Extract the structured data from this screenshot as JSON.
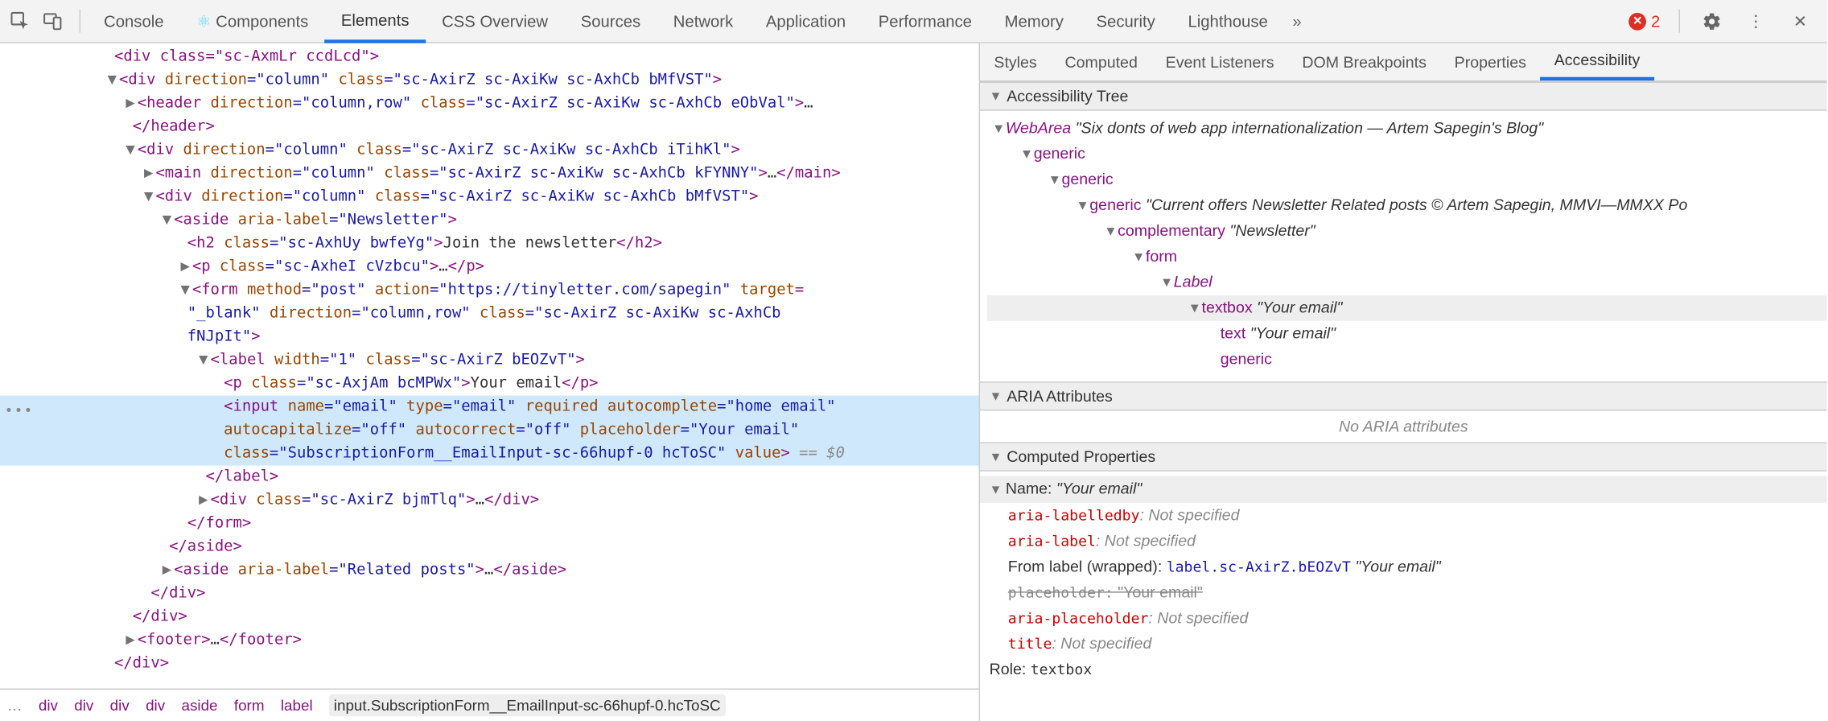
{
  "toolbar": {
    "tabs": [
      "Console",
      "Components",
      "Elements",
      "CSS Overview",
      "Sources",
      "Network",
      "Application",
      "Performance",
      "Memory",
      "Security",
      "Lighthouse"
    ],
    "active": 2,
    "error_count": "2"
  },
  "dom": {
    "l00": "<div class=\"sc-AxmLr ccdLcd\">",
    "l01_open": "<",
    "l01_tag": "div",
    "l01_a1n": " direction",
    "l01_a1v": "=\"column\"",
    "l01_a2n": " class",
    "l01_a2v": "=\"sc-AxirZ sc-AxiKw sc-AxhCb bMfVST\"",
    "l01_close": ">",
    "l02_open": "<",
    "l02_tag": "header",
    "l02_a1n": " direction",
    "l02_a1v": "=\"column,row\"",
    "l02_a2n": " class",
    "l02_a2v": "=\"sc-AxirZ sc-AxiKw sc-AxhCb eObVal\"",
    "l02_close": ">",
    "l02_ell": "…",
    "l03": "</header>",
    "l04_open": "<",
    "l04_tag": "div",
    "l04_a1n": " direction",
    "l04_a1v": "=\"column\"",
    "l04_a2n": " class",
    "l04_a2v": "=\"sc-AxirZ sc-AxiKw sc-AxhCb iTihKl\"",
    "l04_close": ">",
    "l05_open": "<",
    "l05_tag": "main",
    "l05_a1n": " direction",
    "l05_a1v": "=\"column\"",
    "l05_a2n": " class",
    "l05_a2v": "=\"sc-AxirZ sc-AxiKw sc-AxhCb kFYNNY\"",
    "l05_close": ">",
    "l05_ell": "…",
    "l05_end": "</main>",
    "l06_open": "<",
    "l06_tag": "div",
    "l06_a1n": " direction",
    "l06_a1v": "=\"column\"",
    "l06_a2n": " class",
    "l06_a2v": "=\"sc-AxirZ sc-AxiKw sc-AxhCb bMfVST\"",
    "l06_close": ">",
    "l07_open": "<",
    "l07_tag": "aside",
    "l07_a1n": " aria-label",
    "l07_a1v": "=\"Newsletter\"",
    "l07_close": ">",
    "l08_open": "<",
    "l08_tag": "h2",
    "l08_a1n": " class",
    "l08_a1v": "=\"sc-AxhUy bwfeYg\"",
    "l08_close": ">",
    "l08_text": "Join the newsletter",
    "l08_end": "</h2>",
    "l09_open": "<",
    "l09_tag": "p",
    "l09_a1n": " class",
    "l09_a1v": "=\"sc-AxheI cVzbcu\"",
    "l09_close": ">",
    "l09_ell": "…",
    "l09_end": "</p>",
    "l10_open": "<",
    "l10_tag": "form",
    "l10_a1n": " method",
    "l10_a1v": "=\"post\"",
    "l10_a2n": " action",
    "l10_a2v": "=\"https://tinyletter.com/sapegin\"",
    "l10_a3n": " target",
    "l10_close": "=",
    "l11_a3v": "\"_blank\"",
    "l11_a4n": " direction",
    "l11_a4v": "=\"column,row\"",
    "l11_a5n": " class",
    "l11_a5v": "=\"sc-AxirZ sc-AxiKw sc-AxhCb",
    "l12_cont": "fNJpIt\"",
    "l12_close": ">",
    "l13_open": "<",
    "l13_tag": "label",
    "l13_a1n": " width",
    "l13_a1v": "=\"1\"",
    "l13_a2n": " class",
    "l13_a2v": "=\"sc-AxirZ bEOZvT\"",
    "l13_close": ">",
    "l14_open": "<",
    "l14_tag": "p",
    "l14_a1n": " class",
    "l14_a1v": "=\"sc-AxjAm bcMPWx\"",
    "l14_close": ">",
    "l14_text": "Your email",
    "l14_end": "</p>",
    "l15_open": "<",
    "l15_tag": "input",
    "l15_a1n": " name",
    "l15_a1v": "=\"email\"",
    "l15_a2n": " type",
    "l15_a2v": "=\"email\"",
    "l15_a3n": " required",
    "l15_a4n": " autocomplete",
    "l15_a4v": "=\"home email\"",
    "l16_a5n": "autocapitalize",
    "l16_a5v": "=\"off\"",
    "l16_a6n": " autocorrect",
    "l16_a6v": "=\"off\"",
    "l16_a7n": " placeholder",
    "l16_a7v": "=\"Your email\"",
    "l17_a8n": "class",
    "l17_a8v": "=\"SubscriptionForm__EmailInput-sc-66hupf-0 hcToSC\"",
    "l17_a9n": " value",
    "l17_close": ">",
    "l17_eq": " == ",
    "l17_dollar": "$0",
    "l18": "</label>",
    "l19_open": "<",
    "l19_tag": "div",
    "l19_a1n": " class",
    "l19_a1v": "=\"sc-AxirZ bjmTlq\"",
    "l19_close": ">",
    "l19_ell": "…",
    "l19_end": "</div>",
    "l20": "</form>",
    "l21": "</aside>",
    "l22_open": "<",
    "l22_tag": "aside",
    "l22_a1n": " aria-label",
    "l22_a1v": "=\"Related posts\"",
    "l22_close": ">",
    "l22_ell": "…",
    "l22_end": "</aside>",
    "l23": "</div>",
    "l24": "</div>",
    "l25_open": "<",
    "l25_tag": "footer",
    "l25_close": ">",
    "l25_ell": "…",
    "l25_end": "</footer>",
    "l26": "</div>"
  },
  "breadcrumb": {
    "dots": "…",
    "items": [
      "div",
      "div",
      "div",
      "div",
      "aside",
      "form",
      "label"
    ],
    "selected": "input.SubscriptionForm__EmailInput-sc-66hupf-0.hcToSC"
  },
  "side": {
    "tabs": [
      "Styles",
      "Computed",
      "Event Listeners",
      "DOM Breakpoints",
      "Properties",
      "Accessibility"
    ],
    "active": 5,
    "sections": {
      "tree": "Accessibility Tree",
      "aria": "ARIA Attributes",
      "computed": "Computed Properties"
    },
    "acc_tree": {
      "r0_role": "WebArea",
      "r0_name": "\"Six donts of web app internationalization — Artem Sapegin's Blog\"",
      "r1_role": "generic",
      "r2_role": "generic",
      "r3_role": "generic",
      "r3_name": "\"Current offers Newsletter Related posts © Artem Sapegin, MMVI—MMXX Po",
      "r4_role": "complementary",
      "r4_name": "\"Newsletter\"",
      "r5_role": "form",
      "r6_role": "Label",
      "r7_role": "textbox",
      "r7_name": "\"Your email\"",
      "r8_role": "text",
      "r8_name": "\"Your email\"",
      "r9_role": "generic"
    },
    "no_aria": "No ARIA attributes",
    "computed": {
      "name_label": "Name: ",
      "name_value": "\"Your email\"",
      "labelledby": "aria-labelledby",
      "labelledby_v": ": Not specified",
      "arialabel": "aria-label",
      "arialabel_v": ": Not specified",
      "fromlabel": "From label (wrapped): ",
      "fromlabel_ref": "label.sc-AxirZ.bEOZvT",
      "fromlabel_name": " \"Your email\"",
      "placeholder": "placeholder:",
      "placeholder_v": " \"Your email\" ",
      "ariaplaceholder": "aria-placeholder",
      "ariaplaceholder_v": ": Not specified",
      "title": "title",
      "title_v": ": Not specified",
      "role_label": "Role: ",
      "role_value": "textbox"
    }
  }
}
